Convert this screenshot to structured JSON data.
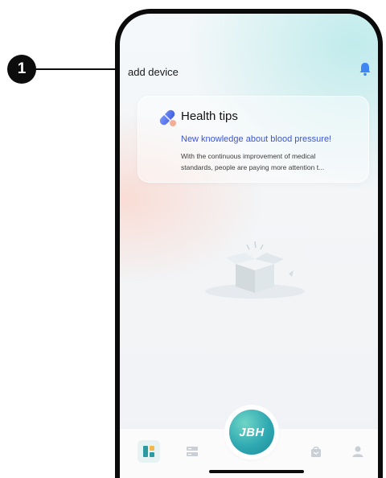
{
  "annotation": {
    "marker": "1"
  },
  "header": {
    "add_device_label": "add device",
    "bell_icon": "bell-icon"
  },
  "health_tips": {
    "icon": "capsule-icon",
    "title": "Health tips",
    "headline": "New knowledge about blood pressure!",
    "body_lines": [
      "With the continuous improvement of medical",
      "standards, people are paying more attention t..."
    ]
  },
  "empty_state": {
    "icon": "empty-box-illustration"
  },
  "tabbar": {
    "tabs": [
      {
        "name": "home",
        "icon": "dashboard-icon",
        "active": true
      },
      {
        "name": "records",
        "icon": "list-icon",
        "active": false
      },
      {
        "name": "mall",
        "icon": "shopping-bag-icon",
        "active": false
      },
      {
        "name": "profile",
        "icon": "person-icon",
        "active": false
      }
    ],
    "center_button_label": "JBH"
  },
  "colors": {
    "accent_teal": "#2fa9b2",
    "link_blue": "#3b55d6",
    "bell_blue": "#3f86f4",
    "active_tab": "#2c9aa0"
  }
}
